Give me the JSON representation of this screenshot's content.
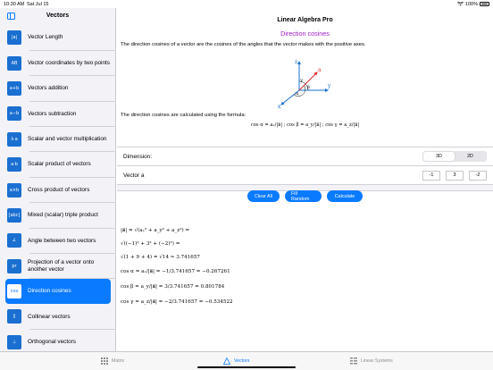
{
  "status": {
    "time": "10:30 AM",
    "date": "Sat Jul 15",
    "battery": "100%"
  },
  "sidebar": {
    "title": "Vectors",
    "items": [
      {
        "label": "Vector Length",
        "icon": "|a|"
      },
      {
        "label": "Vector coordinates by two points",
        "icon": "AB"
      },
      {
        "label": "Vectors addition",
        "icon": "a+b"
      },
      {
        "label": "Vectors subtraction",
        "icon": "a−b"
      },
      {
        "label": "Scalar and vector multiplication",
        "icon": "λ·a"
      },
      {
        "label": "Scalar product of vectors",
        "icon": "a·b"
      },
      {
        "label": "Cross product of vectors",
        "icon": "a×b"
      },
      {
        "label": "Mixed (scalar) triple product",
        "icon": "[abc]"
      },
      {
        "label": "Angle between two vectors",
        "icon": "∠"
      },
      {
        "label": "Projection of a vector onto another vector",
        "icon": "pr"
      },
      {
        "label": "Direction cosines",
        "icon": "cos"
      },
      {
        "label": "Collinear vectors",
        "icon": "∥"
      },
      {
        "label": "Orthogonal vectors",
        "icon": "⊥"
      }
    ],
    "selected_index": 10
  },
  "main": {
    "title": "Linear Algebra Pro",
    "section_title": "Direction cosines",
    "description": "The direction cosines of a vector are the cosines of the angles that the vector makes with the positive axes.",
    "diagram_labels": {
      "z": "z",
      "y": "y",
      "x": "x",
      "a": "a",
      "alpha": "α",
      "beta": "β",
      "gamma": "γ"
    },
    "formula_intro": "The direction cosines are calculated using the formula:",
    "formula": "cos α = aₓ/|a⃗| ; cos β = a_y/|a⃗| ; cos γ = a_z/|a⃗|",
    "dimension_label": "Dimension:",
    "dimension_options": [
      "3D",
      "2D"
    ],
    "dimension_selected": "3D",
    "vector_label": "Vector a",
    "vector_values": [
      "-1",
      "3",
      "-2"
    ],
    "buttons": {
      "clear": "Clear All",
      "fill": "Fill Random",
      "calculate": "Calculate"
    },
    "results": [
      "|a⃗| = √(aₓ² + a_y² + a_z²) =",
      "√((−1)² + 3² + (−2)²) =",
      "√(1 + 9 + 4) = √14 ≈ 3.741657",
      "cos α = aₓ/|a⃗| = −1/3.741657 = −0.267261",
      "cos β = a_y/|a⃗| = 3/3.741657 = 0.801784",
      "cos γ = a_z/|a⃗| = −2/3.741657 = −0.534522"
    ]
  },
  "tabbar": {
    "tabs": [
      {
        "label": "Matrix",
        "icon": "grid-icon"
      },
      {
        "label": "Vectors",
        "icon": "vectors-icon"
      },
      {
        "label": "Linear Systems",
        "icon": "linear-systems-icon"
      }
    ],
    "active": "Vectors"
  },
  "colors": {
    "accent": "#0a7aff",
    "section_title": "#a020c8",
    "sidebar_bg": "#f2f2f7"
  }
}
